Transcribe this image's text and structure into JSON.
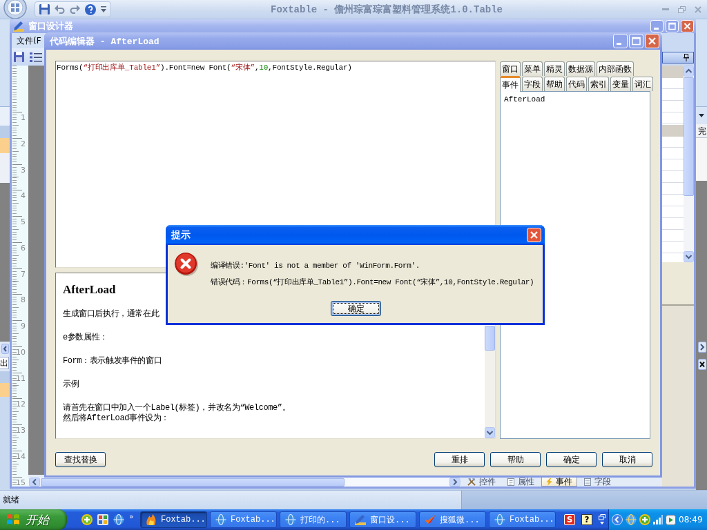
{
  "app_window": {
    "title": "Foxtable - 儋州琮富琮富塑料管理系统1.0.Table",
    "left_edge_tab": "出",
    "right_edge_header": "完",
    "status_text": "就绪"
  },
  "designer_window": {
    "title": "窗口设计器",
    "menu": [
      "文件(F"
    ],
    "ruler_numbers": [
      "1",
      "2",
      "3",
      "4",
      "5",
      "6",
      "7",
      "8",
      "9",
      "10",
      "11",
      "12",
      "13",
      "14",
      "15"
    ],
    "bottom_tabs": [
      {
        "label": "控件",
        "kind": "tools",
        "selected": false
      },
      {
        "label": "属性",
        "kind": "document",
        "selected": false
      },
      {
        "label": "事件",
        "kind": "lightning",
        "selected": true
      },
      {
        "label": "字段",
        "kind": "list",
        "selected": false
      }
    ]
  },
  "code_editor": {
    "title": "代码编辑器 - AfterLoad",
    "code_line": [
      {
        "kind": "plain",
        "text": "Forms("
      },
      {
        "kind": "string",
        "text": "“打印出库单_Table1”"
      },
      {
        "kind": "plain",
        "text": ").Font=new Font("
      },
      {
        "kind": "string",
        "text": "“宋体”"
      },
      {
        "kind": "plain",
        "text": ","
      },
      {
        "kind": "number",
        "text": "10"
      },
      {
        "kind": "plain",
        "text": ",FontStyle.Regular)"
      }
    ],
    "help": {
      "heading": "AfterLoad",
      "paragraphs": [
        [
          "生成窗口后执行，通常在此"
        ],
        [
          "e参数属性："
        ],
        [
          "Form：表示触发事件的窗口"
        ],
        [
          "示例"
        ],
        [
          "请首先在窗口中加入一个Label(标签)，并改名为“Welcome”。",
          "然后将AfterLoad事件设为："
        ]
      ]
    },
    "tab_rows": [
      [
        {
          "label": "窗口",
          "selected": false
        },
        {
          "label": "菜单",
          "selected": false
        },
        {
          "label": "精灵",
          "selected": false
        },
        {
          "label": "数据源",
          "selected": false
        },
        {
          "label": "内部函数",
          "selected": false
        }
      ],
      [
        {
          "label": "事件",
          "selected": true
        },
        {
          "label": "字段",
          "selected": false
        },
        {
          "label": "帮助",
          "selected": false
        },
        {
          "label": "代码",
          "selected": false
        },
        {
          "label": "索引",
          "selected": false
        },
        {
          "label": "变量",
          "selected": false
        },
        {
          "label": "词汇",
          "selected": false
        }
      ]
    ],
    "event_list": [
      {
        "label": "AfterLoad",
        "selected": false
      }
    ],
    "left_buttons": [
      "查找替换"
    ],
    "right_buttons": [
      "重排",
      "帮助",
      "确定",
      "取消"
    ]
  },
  "message_box": {
    "title": "提示",
    "lines": [
      "编译错误:'Font' is not a member of 'WinForm.Form'.",
      "错误代码：Forms(“打印出库单_Table1”).Font=new Font(“宋体”,10,FontStyle.Regular)"
    ],
    "button": "确定"
  },
  "taskbar": {
    "start_label": "开始",
    "overflow": "»",
    "tasks": [
      {
        "label": "Foxtab...",
        "kind": "flame",
        "selected": true
      },
      {
        "label": "Foxtab...",
        "kind": "globe",
        "selected": false
      },
      {
        "label": "打印的...",
        "kind": "globe",
        "selected": false
      },
      {
        "label": "窗口设...",
        "kind": "pencil",
        "selected": false
      },
      {
        "label": "搜狐微...",
        "kind": "swoosh",
        "selected": false
      },
      {
        "label": "Foxtab...",
        "kind": "globe",
        "selected": false
      }
    ],
    "tray_badges": [
      {
        "text": "S",
        "kind": "square"
      },
      {
        "text": "?",
        "kind": "note"
      }
    ],
    "clock": "08:49"
  }
}
